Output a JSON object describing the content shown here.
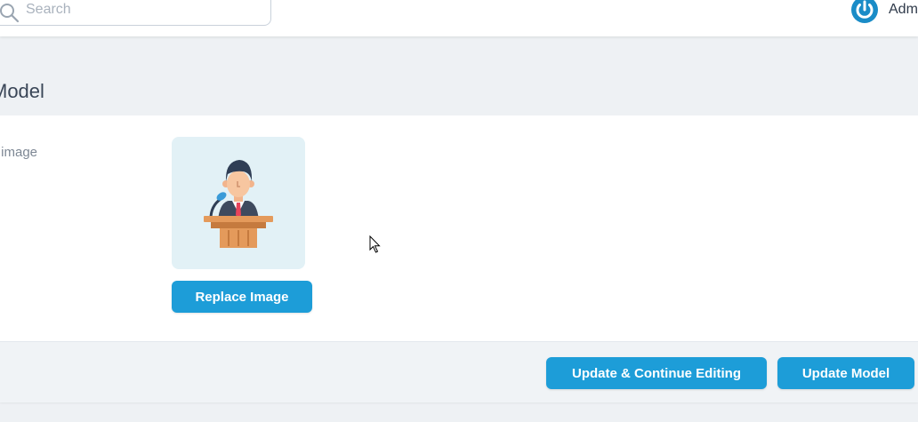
{
  "search": {
    "placeholder": "Search",
    "value": ""
  },
  "user": {
    "name": "Admin"
  },
  "page": {
    "title": "Model"
  },
  "form": {
    "image_field_label": "ile image",
    "replace_button_label": "Replace Image"
  },
  "footer": {
    "update_continue_label": "Update & Continue Editing",
    "update_label": "Update Model"
  },
  "colors": {
    "primary": "#1d9dd8",
    "page_bg": "#eef1f4",
    "preview_bg": "#e2f1f6",
    "power_icon": "#1a8cc7"
  },
  "icons": {
    "search": "search-icon",
    "user_status": "power-icon",
    "image": "speaker-at-podium-icon"
  }
}
